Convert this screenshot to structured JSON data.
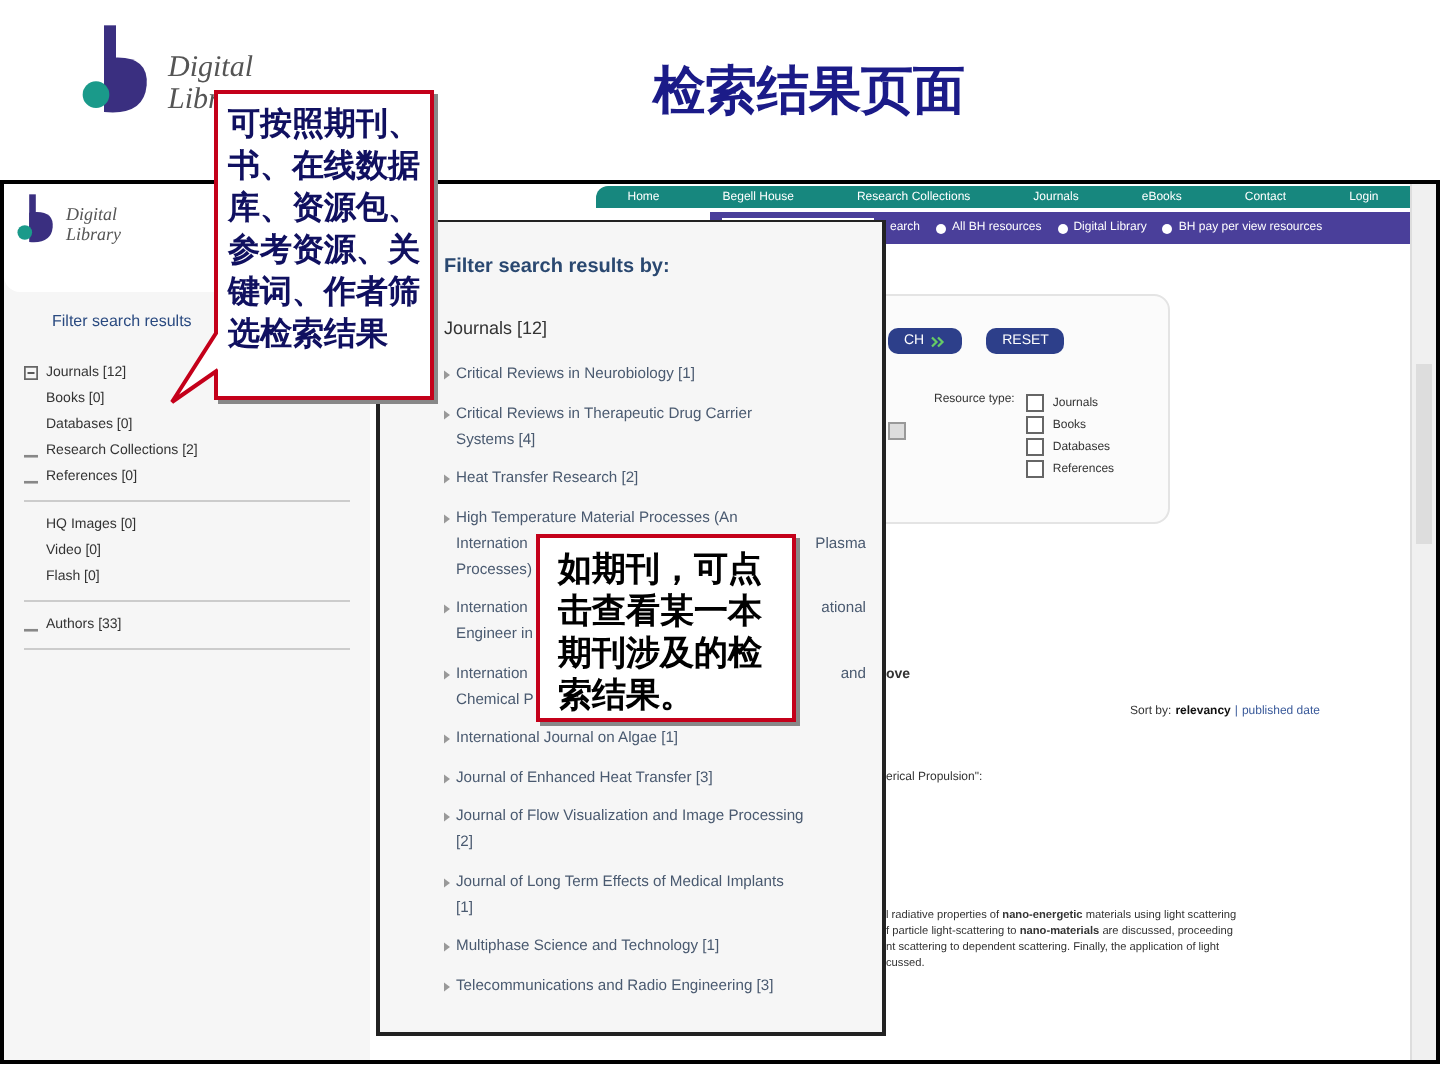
{
  "slide": {
    "logo": {
      "line1": "Digital",
      "line2": "Libr"
    },
    "title": "检索结果页面"
  },
  "screenshot": {
    "sidebar": {
      "logo": {
        "line1": "Digital",
        "line2": "Library"
      },
      "title": "Filter search results",
      "groups": [
        [
          {
            "label": "Journals [12]",
            "kind": "expandable",
            "expanded": true
          },
          {
            "label": "Books [0]",
            "kind": "plain"
          },
          {
            "label": "Databases [0]",
            "kind": "plain"
          },
          {
            "label": "Research Collections [2]",
            "kind": "expandable",
            "expanded": false
          },
          {
            "label": "References [0]",
            "kind": "expandable",
            "expanded": false
          }
        ],
        [
          {
            "label": "HQ Images [0]",
            "kind": "plain"
          },
          {
            "label": "Video [0]",
            "kind": "plain"
          },
          {
            "label": "Flash [0]",
            "kind": "plain"
          }
        ],
        [
          {
            "label": "Authors [33]",
            "kind": "expandable",
            "expanded": false
          }
        ]
      ]
    },
    "nav": [
      "Home",
      "Begell House",
      "Research Collections",
      "Journals",
      "eBooks",
      "Contact",
      "Login"
    ],
    "search_bar": {
      "button": "earch",
      "links": [
        "All BH resources",
        "Digital Library",
        "BH pay per view resources"
      ]
    },
    "search_panel": {
      "search_button": "CH",
      "reset_button": "RESET",
      "resource_type_label": "Resource type:",
      "resource_types": [
        {
          "label": "Journals",
          "checked": false
        },
        {
          "label": "Books",
          "checked": false
        },
        {
          "label": "Databases",
          "checked": false
        },
        {
          "label": "References",
          "checked": false
        }
      ]
    },
    "results": {
      "heading_fragment": "ove",
      "sort_label": "Sort by:",
      "sort_separator": "|",
      "sort_options": [
        {
          "label": "relevancy",
          "selected": true
        },
        {
          "label": "published date",
          "selected": false
        }
      ],
      "title_fragment": "erical Propulsion\":",
      "abstract_lines": [
        "l radiative properties of **nano-energetic** materials using light scattering",
        "f particle light-scattering to **nano-materials** are discussed, proceeding",
        "nt scattering to dependent scattering. Finally, the application of light",
        "cussed."
      ]
    },
    "popup": {
      "title": "Filter search results by:",
      "group": "Journals [12]",
      "items": [
        {
          "lines": [
            {
              "text": "Critical Reviews in Neurobiology [1]"
            }
          ]
        },
        {
          "lines": [
            {
              "text": "Critical Reviews in Therapeutic Drug Carrier"
            },
            {
              "text": "Systems [4]"
            }
          ]
        },
        {
          "lines": [
            {
              "text": "Heat Transfer Research [2]"
            }
          ]
        },
        {
          "lines": [
            {
              "text": "High Temperature Material Processes (An"
            },
            {
              "text": "Internation",
              "tail": "Plasma"
            },
            {
              "text": "Processes)"
            }
          ]
        },
        {
          "lines": [
            {
              "text": "Internation",
              "tail": "ational"
            },
            {
              "text": "Engineer in"
            }
          ]
        },
        {
          "lines": [
            {
              "text": "Internation",
              "tail": "and"
            },
            {
              "text": "Chemical P"
            }
          ]
        },
        {
          "lines": [
            {
              "text": "International Journal on Algae [1]"
            }
          ]
        },
        {
          "lines": [
            {
              "text": "Journal of Enhanced Heat Transfer [3]"
            }
          ]
        },
        {
          "lines": [
            {
              "text": "Journal of Flow Visualization and Image Processing"
            },
            {
              "text": "[2]"
            }
          ]
        },
        {
          "lines": [
            {
              "text": "Journal of Long Term Effects of Medical Implants"
            },
            {
              "text": "[1]"
            }
          ]
        },
        {
          "lines": [
            {
              "text": "Multiphase Science and Technology [1]"
            }
          ]
        },
        {
          "lines": [
            {
              "text": "Telecommunications and Radio Engineering [3]"
            }
          ]
        }
      ]
    }
  },
  "callouts": [
    {
      "text": "可按照期刊、书、在线数据库、资源包、参考资源、关键词、作者筛选检索结果",
      "pointer": true
    },
    {
      "text": "如期刊，可点击查看某一本期刊涉及的检索结果。",
      "pointer": false
    }
  ]
}
